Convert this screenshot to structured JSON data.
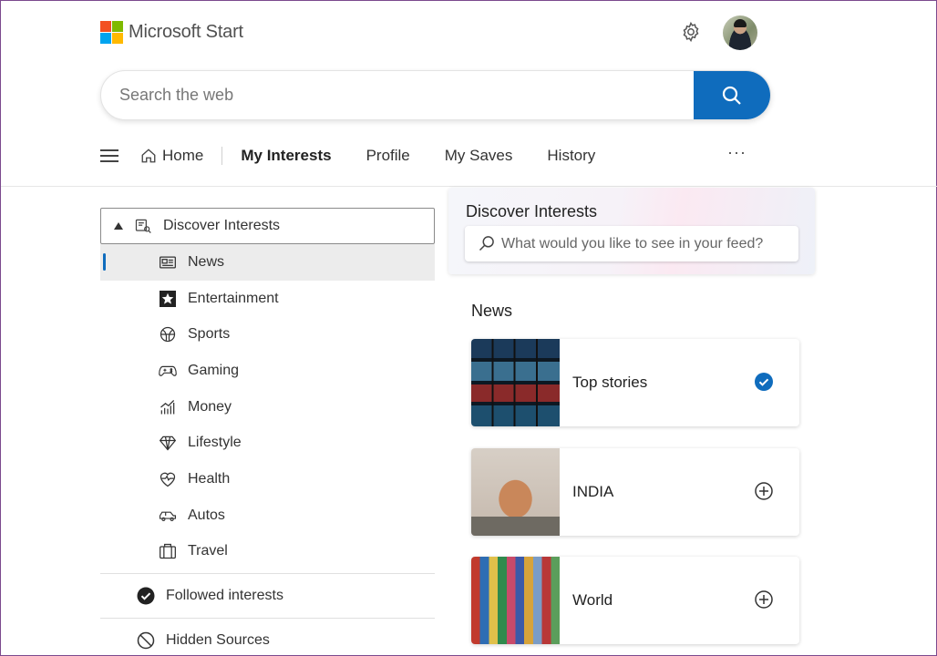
{
  "header": {
    "logo_text": "Microsoft Start",
    "logo_colors": [
      "#f25022",
      "#7fba00",
      "#00a4ef",
      "#ffb900"
    ],
    "settings_icon": "gear-icon",
    "avatar": "user-avatar"
  },
  "search": {
    "placeholder": "Search the web",
    "button_icon": "search-icon",
    "accent": "#0f6cbd"
  },
  "nav": {
    "items": [
      "Home",
      "My Interests",
      "Profile",
      "My Saves",
      "History"
    ],
    "active": "My Interests",
    "more": "···"
  },
  "sidebar": {
    "header": "Discover Interests",
    "items": [
      {
        "label": "News",
        "icon": "newspaper-icon",
        "selected": true
      },
      {
        "label": "Entertainment",
        "icon": "star-icon"
      },
      {
        "label": "Sports",
        "icon": "sports-ball-icon"
      },
      {
        "label": "Gaming",
        "icon": "gamepad-icon"
      },
      {
        "label": "Money",
        "icon": "chart-icon"
      },
      {
        "label": "Lifestyle",
        "icon": "diamond-icon"
      },
      {
        "label": "Health",
        "icon": "heart-pulse-icon"
      },
      {
        "label": "Autos",
        "icon": "car-icon"
      },
      {
        "label": "Travel",
        "icon": "suitcase-icon"
      }
    ],
    "followed": "Followed interests",
    "hidden": "Hidden Sources"
  },
  "discover": {
    "title": "Discover Interests",
    "placeholder": "What would you like to see in your feed?"
  },
  "news": {
    "title": "News",
    "cards": [
      {
        "label": "Top stories",
        "state": "followed"
      },
      {
        "label": "INDIA",
        "state": "add"
      },
      {
        "label": "World",
        "state": "add"
      }
    ]
  }
}
